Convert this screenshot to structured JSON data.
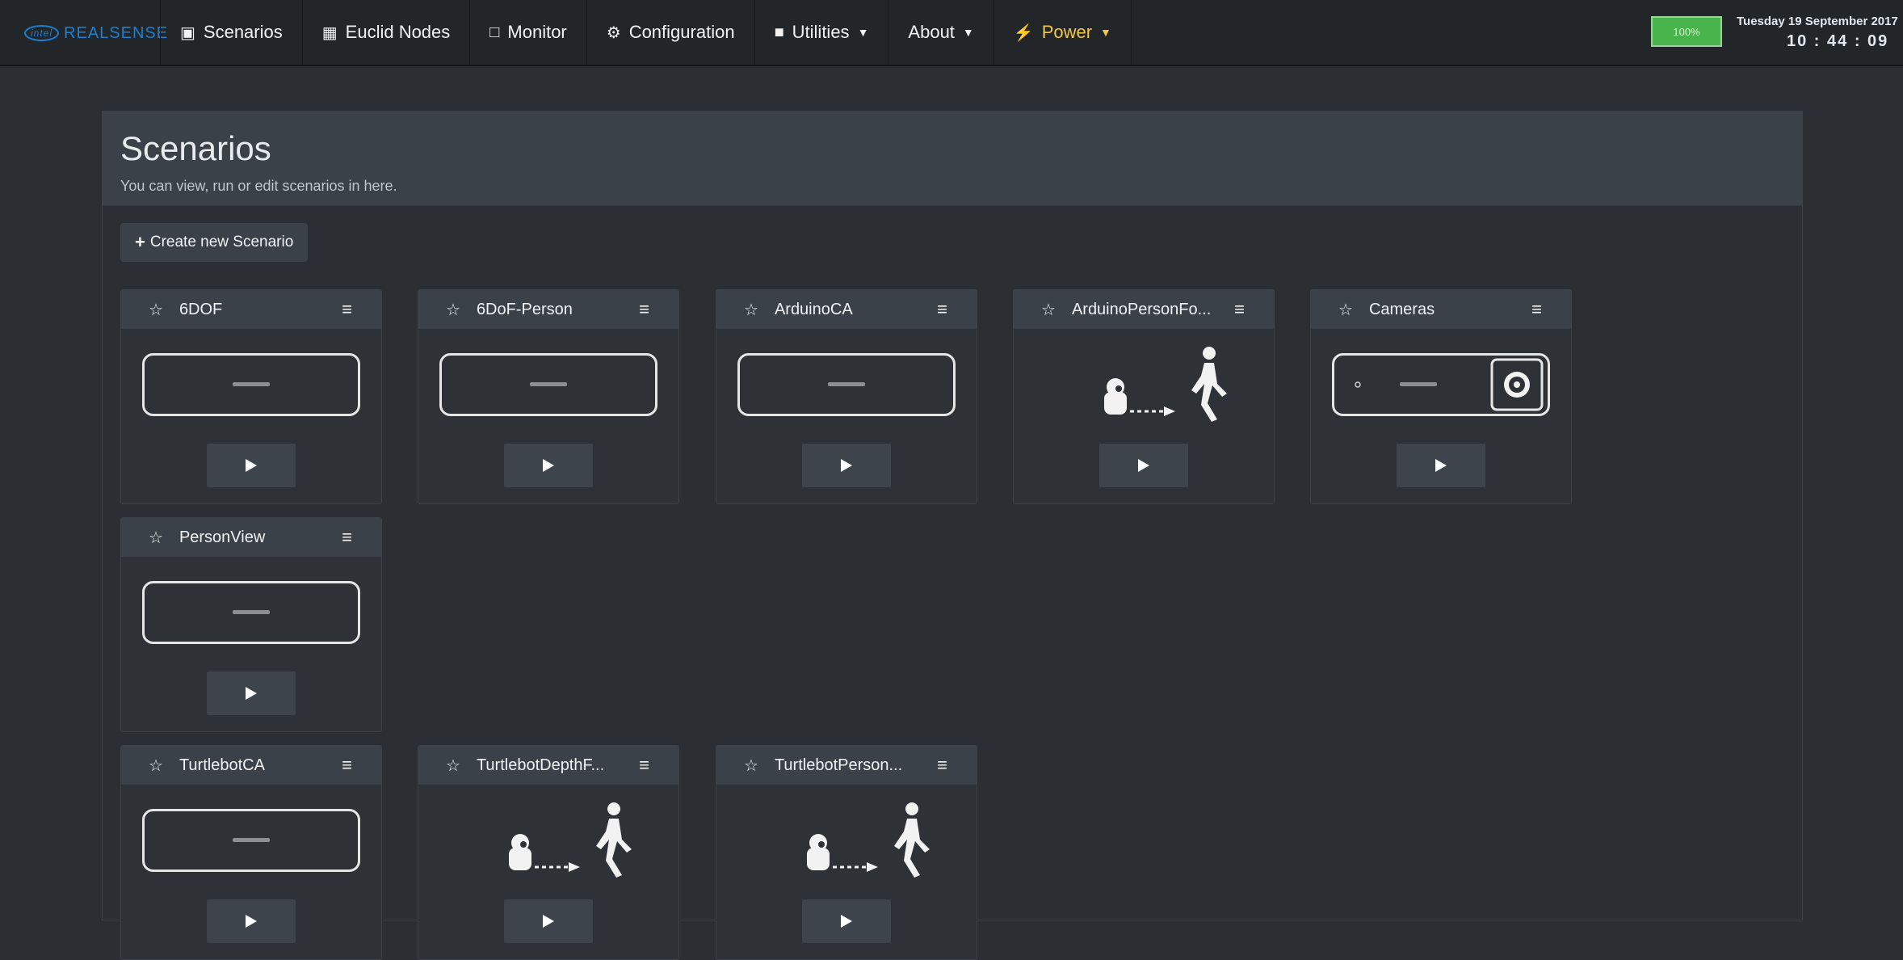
{
  "navbar": {
    "brand_intel": "intel",
    "brand_name": "REALSENSE",
    "items": [
      {
        "label": "Scenarios",
        "icon": "scenarios-icon"
      },
      {
        "label": "Euclid Nodes",
        "icon": "nodes-icon"
      },
      {
        "label": "Monitor",
        "icon": "monitor-icon"
      },
      {
        "label": "Configuration",
        "icon": "gears-icon"
      },
      {
        "label": "Utilities",
        "icon": "briefcase-icon",
        "dropdown": true
      },
      {
        "label": "About",
        "dropdown": true
      },
      {
        "label": "Power",
        "icon": "bolt-icon",
        "dropdown": true
      }
    ],
    "battery": "100%",
    "date": "Tuesday 19 September 2017",
    "time": "10 : 44 : 09"
  },
  "page": {
    "title": "Scenarios",
    "subtitle": "You can view, run or edit scenarios in here.",
    "create_label": "Create new Scenario"
  },
  "scenarios": [
    {
      "name": "6DOF",
      "image": "camera"
    },
    {
      "name": "6DoF-Person",
      "image": "camera"
    },
    {
      "name": "ArduinoCA",
      "image": "camera"
    },
    {
      "name": "ArduinoPersonFo...",
      "image": "robot-person"
    },
    {
      "name": "Cameras",
      "image": "camera-lens"
    },
    {
      "name": "PersonView",
      "image": "camera"
    },
    {
      "name": "TurtlebotCA",
      "image": "camera"
    },
    {
      "name": "TurtlebotDepthF...",
      "image": "robot-person"
    },
    {
      "name": "TurtlebotPerson...",
      "image": "robot-person"
    }
  ],
  "colors": {
    "accent_power": "#f2c744",
    "battery": "#49b44b",
    "brand": "#1e7fcf"
  }
}
